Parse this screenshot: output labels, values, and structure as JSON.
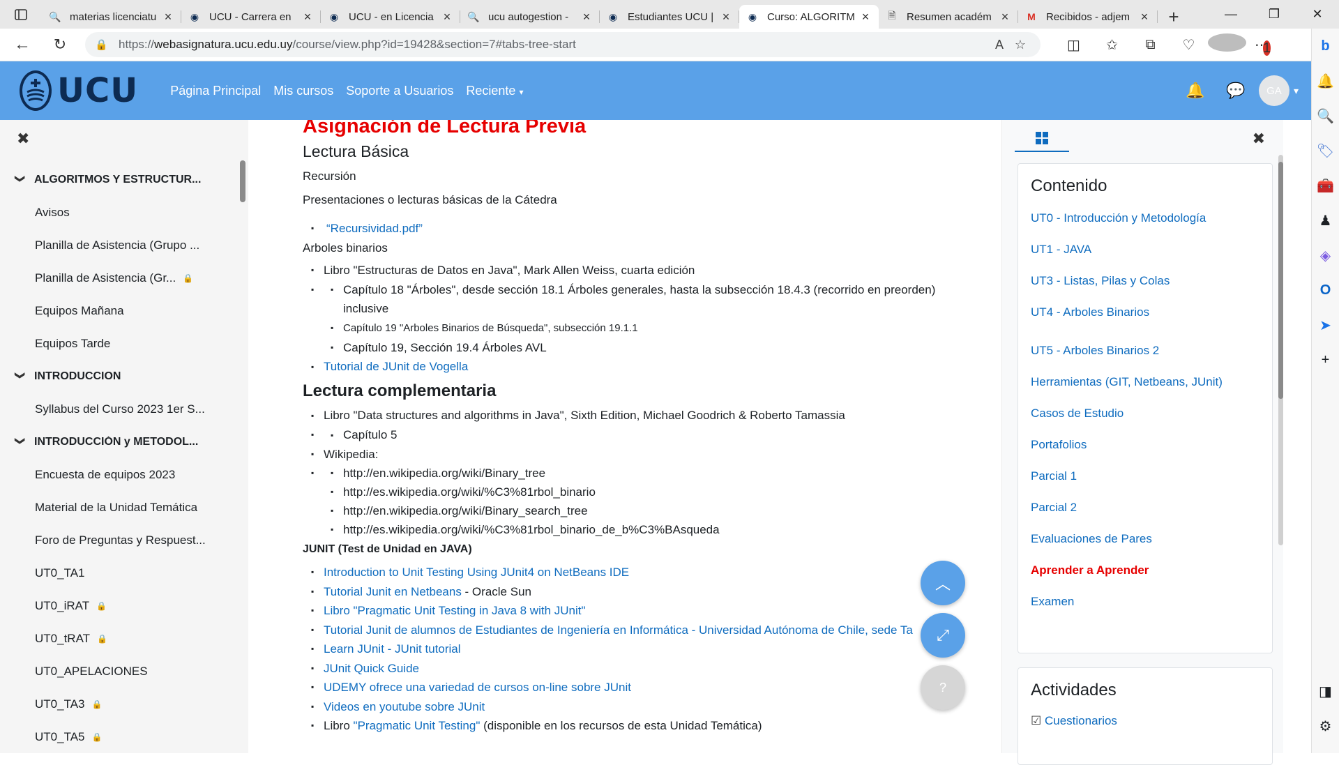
{
  "browser": {
    "tabs": [
      {
        "title": "materias licenciatu",
        "icon": "search-icon",
        "active": false
      },
      {
        "title": "UCU - Carrera en",
        "icon": "ucu-icon",
        "active": false
      },
      {
        "title": "UCU - en Licencia",
        "icon": "ucu-icon",
        "active": false
      },
      {
        "title": "ucu autogestion -",
        "icon": "search-icon",
        "active": false
      },
      {
        "title": "Estudiantes UCU |",
        "icon": "ucu-icon",
        "active": false
      },
      {
        "title": "Curso: ALGORITM",
        "icon": "ucu-icon",
        "active": true
      },
      {
        "title": "Resumen académ",
        "icon": "document-icon",
        "active": false
      },
      {
        "title": "Recibidos - adjem",
        "icon": "gmail-icon",
        "active": false
      }
    ],
    "url_prefix": "https://",
    "url_host": "webasignatura.ucu.edu.uy",
    "url_path": "/course/view.php?id=19428&section=7#tabs-tree-start",
    "extensions_badge": "1"
  },
  "navbar": {
    "logo_text": "UCU",
    "links": [
      "Página Principal",
      "Mis cursos",
      "Soporte a Usuarios",
      "Reciente"
    ],
    "user_initials": "GA"
  },
  "drawer": {
    "items": [
      {
        "type": "section",
        "label": "ALGORITMOS Y ESTRUCTUR..."
      },
      {
        "type": "item",
        "label": "Avisos",
        "locked": false
      },
      {
        "type": "item",
        "label": "Planilla de Asistencia (Grupo ...",
        "locked": false
      },
      {
        "type": "item",
        "label": "Planilla de Asistencia (Gr...",
        "locked": true
      },
      {
        "type": "item",
        "label": "Equipos Mañana",
        "locked": false
      },
      {
        "type": "item",
        "label": "Equipos Tarde",
        "locked": false
      },
      {
        "type": "section",
        "label": "INTRODUCCION"
      },
      {
        "type": "item",
        "label": "Syllabus del Curso 2023 1er S...",
        "locked": false
      },
      {
        "type": "section",
        "label": "INTRODUCCIÓN y METODOL..."
      },
      {
        "type": "item",
        "label": "Encuesta de equipos 2023",
        "locked": false
      },
      {
        "type": "item",
        "label": "Material de la Unidad Temática",
        "locked": false
      },
      {
        "type": "item",
        "label": "Foro de Preguntas y Respuest...",
        "locked": false
      },
      {
        "type": "item",
        "label": "UT0_TA1",
        "locked": false
      },
      {
        "type": "item",
        "label": "UT0_iRAT",
        "locked": true
      },
      {
        "type": "item",
        "label": "UT0_tRAT",
        "locked": true
      },
      {
        "type": "item",
        "label": "UT0_APELACIONES",
        "locked": false
      },
      {
        "type": "item",
        "label": "UT0_TA3",
        "locked": true
      },
      {
        "type": "item",
        "label": "UT0_TA5",
        "locked": true
      }
    ]
  },
  "content": {
    "heading": "Asignación de Lectura Previa",
    "lectura_basica": "Lectura Básica",
    "recursion": "Recursión",
    "presentaciones": "Presentaciones o lecturas básicas de la Cátedra",
    "recursividad_link": "“Recursividad.pdf”",
    "arboles_binarios": "Arboles binarios",
    "libro_weiss": "Libro \"Estructuras de Datos en Java\", Mark Allen Weiss, cuarta edición",
    "cap18": "Capítulo 18 \"Árboles\", desde sección 18.1 Árboles generales, hasta la subsección 18.4.3 (recorrido en preorden) inclusive",
    "cap19_bb": "Capítulo 19 \"Arboles Binarios de Búsqueda\", subsección 19.1.1",
    "cap19_avl": "Capítulo 19, Sección 19.4 Árboles AVL",
    "tutorial_vogella": "Tutorial de JUnit de Vogella",
    "lectura_comp": "Lectura complementaria",
    "libro_goodrich": "Libro \"Data structures and algorithms in Java\", Sixth Edition, Michael Goodrich & Roberto Tamassia",
    "capitulo5": "Capítulo 5",
    "wikipedia": "Wikipedia:",
    "wiki_links": [
      "http://en.wikipedia.org/wiki/Binary_tree",
      "http://es.wikipedia.org/wiki/%C3%81rbol_binario",
      "http://en.wikipedia.org/wiki/Binary_search_tree",
      "http://es.wikipedia.org/wiki/%C3%81rbol_binario_de_b%C3%BAsqueda"
    ],
    "junit_heading": "JUNIT (Test de Unidad en JAVA)",
    "junit_intro": "Introduction to Unit Testing Using JUnit4 on NetBeans IDE",
    "junit_netbeans": "Tutorial Junit en Netbeans",
    "junit_netbeans_suffix": " - Oracle Sun",
    "junit_pragmatic": "Libro \"Pragmatic Unit Testing in Java 8 with JUnit\"",
    "junit_chile": "Tutorial Junit de alumnos de Estudiantes de Ingeniería en Informática - Universidad Autónoma de Chile, sede Ta",
    "junit_learn": "Learn JUnit - JUnit tutorial",
    "junit_quick": "JUnit Quick Guide",
    "junit_udemy": "UDEMY ofrece una variedad de cursos on-line sobre JUnit",
    "junit_youtube": "Videos en youtube sobre JUnit",
    "libro_prefix": "Libro ",
    "libro_pragmatic_link": "\"Pragmatic Unit Testing\"",
    "libro_suffix": " (disponible en los recursos de esta Unidad Temática)"
  },
  "right_drawer": {
    "contenido_title": "Contenido",
    "contenido_items": [
      {
        "label": "UT0 - Introducción y Metodología",
        "highlight": false
      },
      {
        "label": "UT1 - JAVA",
        "highlight": false
      },
      {
        "label": "UT3 - Listas, Pilas y Colas",
        "highlight": false
      },
      {
        "label": "UT4 - Arboles Binarios",
        "highlight": false
      },
      {
        "label": "UT5 - Arboles Binarios 2",
        "highlight": false
      },
      {
        "label": "Herramientas (GIT, Netbeans, JUnit)",
        "highlight": false
      },
      {
        "label": "Casos de Estudio",
        "highlight": false
      },
      {
        "label": "Portafolios",
        "highlight": false
      },
      {
        "label": "Parcial 1",
        "highlight": false
      },
      {
        "label": "Parcial 2",
        "highlight": false
      },
      {
        "label": "Evaluaciones de Pares",
        "highlight": false
      },
      {
        "label": "Aprender a Aprender",
        "highlight": true
      },
      {
        "label": "Examen",
        "highlight": false
      }
    ],
    "actividades_title": "Actividades",
    "actividades_first": "Cuestionarios"
  },
  "fabs": {
    "help_label": "?"
  },
  "colors": {
    "navbar": "#5aa1e8",
    "link": "#0f6cbf",
    "heading_red": "#e60000",
    "logo_dark": "#0d2b52"
  }
}
